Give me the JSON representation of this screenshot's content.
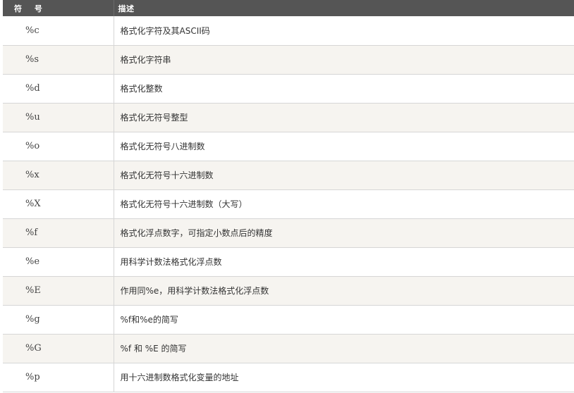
{
  "header": {
    "symbol": "符 号",
    "description": "描述"
  },
  "rows": [
    {
      "symbol": "%c",
      "description": "格式化字符及其ASCII码"
    },
    {
      "symbol": "%s",
      "description": "格式化字符串"
    },
    {
      "symbol": "%d",
      "description": "格式化整数"
    },
    {
      "symbol": "%u",
      "description": "格式化无符号整型"
    },
    {
      "symbol": "%o",
      "description": "格式化无符号八进制数"
    },
    {
      "symbol": "%x",
      "description": "格式化无符号十六进制数"
    },
    {
      "symbol": "%X",
      "description": "格式化无符号十六进制数（大写）"
    },
    {
      "symbol": "%f",
      "description": "格式化浮点数字，可指定小数点后的精度"
    },
    {
      "symbol": "%e",
      "description": "用科学计数法格式化浮点数"
    },
    {
      "symbol": "%E",
      "description": "作用同%e，用科学计数法格式化浮点数"
    },
    {
      "symbol": "%g",
      "description": "%f和%e的简写"
    },
    {
      "symbol": "%G",
      "description": "%f 和 %E 的简写"
    },
    {
      "symbol": "%p",
      "description": "用十六进制数格式化变量的地址"
    }
  ],
  "colors": {
    "header_bg": "#555555",
    "header_text": "#ffffff",
    "row_alt_bg": "#f6f4f0",
    "border": "#d6d6d6"
  }
}
